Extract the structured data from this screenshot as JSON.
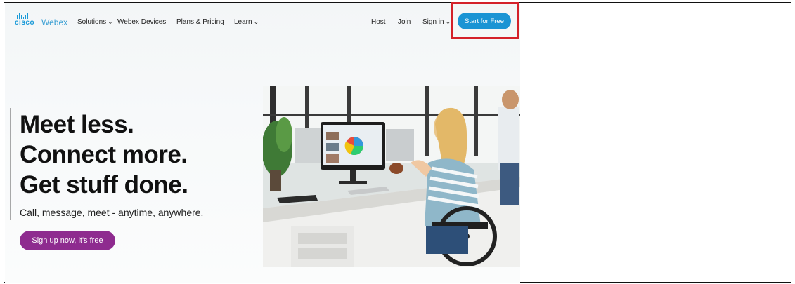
{
  "nav": {
    "logo_brand": "cisco",
    "logo_product": "Webex",
    "items": [
      {
        "label": "Solutions",
        "has_caret": true
      },
      {
        "label": "Webex Devices",
        "has_caret": false
      },
      {
        "label": "Plans & Pricing",
        "has_caret": false
      },
      {
        "label": "Learn",
        "has_caret": true
      }
    ],
    "right_items": [
      {
        "label": "Host"
      },
      {
        "label": "Join"
      },
      {
        "label": "Sign in",
        "has_caret": true
      }
    ],
    "start_button": "Start for Free"
  },
  "hero": {
    "headline": [
      "Meet less.",
      "Connect more.",
      "Get stuff done."
    ],
    "subline": "Call, message, meet - anytime, anywhere.",
    "cta": "Sign up now, it's free"
  },
  "colors": {
    "brand_blue": "#1a94d4",
    "cta_purple": "#8e2b8f",
    "highlight_red": "#d4212a"
  },
  "icons": {
    "caret": "chevron-down-icon"
  }
}
